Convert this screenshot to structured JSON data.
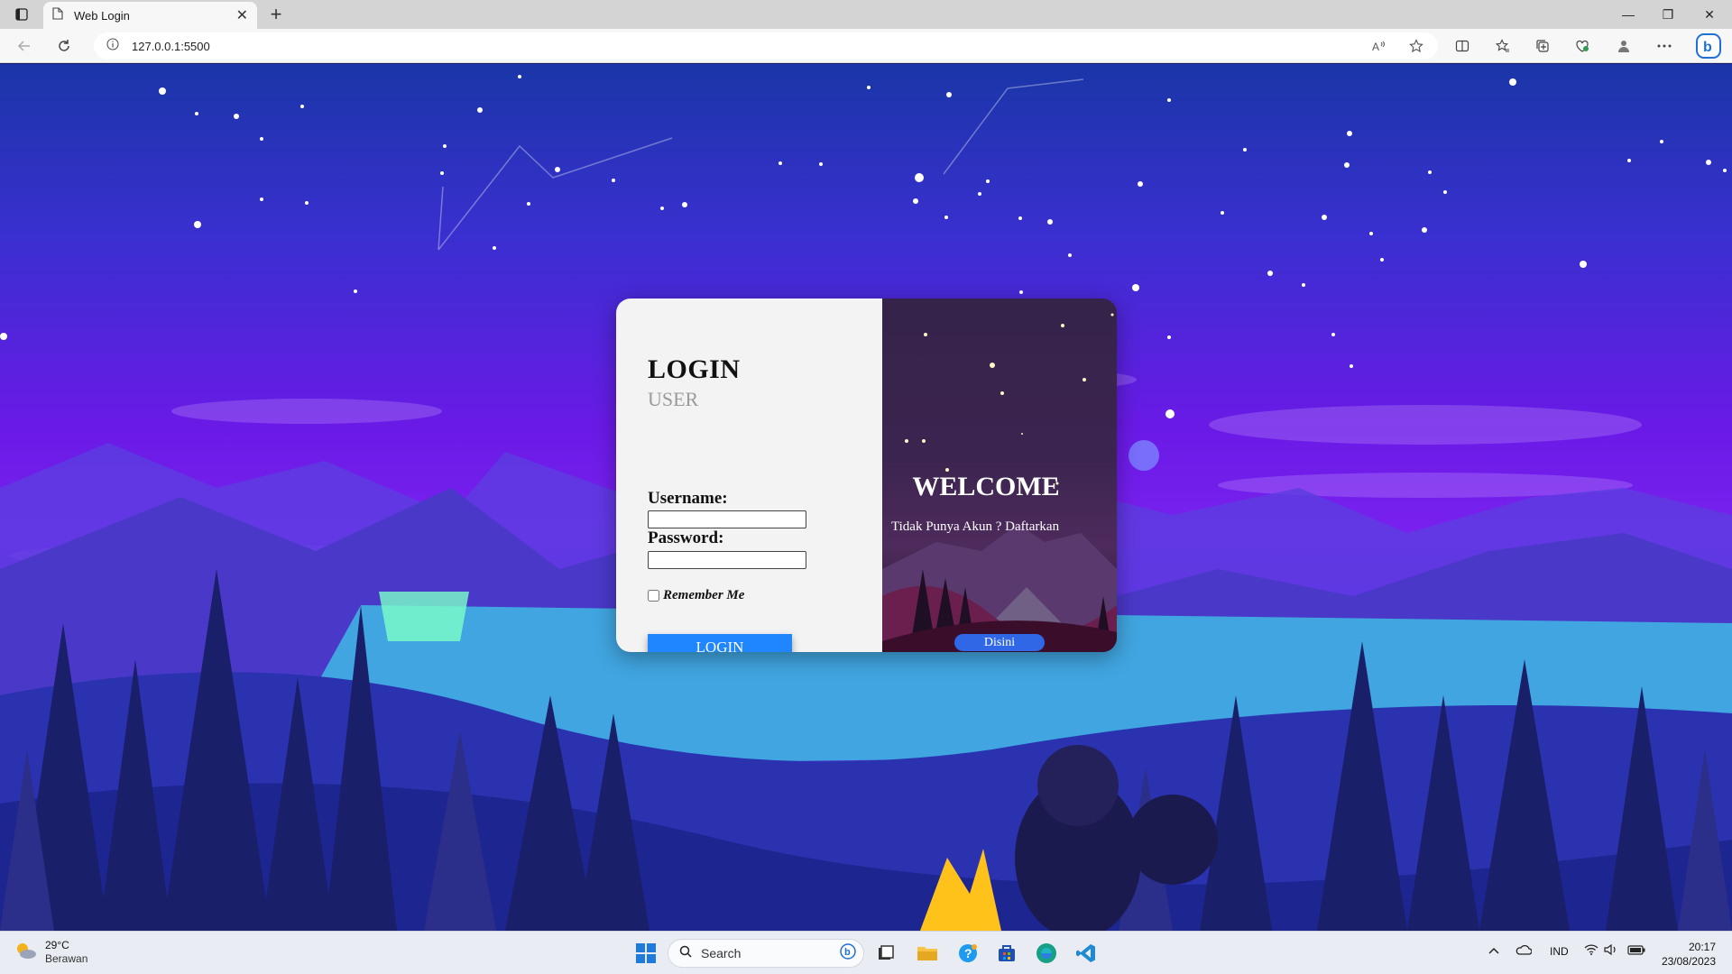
{
  "browser": {
    "tab_title": "Web Login",
    "tab_close": "✕",
    "new_tab": "+",
    "url": "127.0.0.1:5500",
    "min": "—",
    "restore": "❐",
    "close": "✕"
  },
  "login": {
    "title": "LOGIN",
    "subtitle": "USER",
    "username_label": "Username:",
    "password_label": "Password:",
    "remember_label": "Remember Me",
    "button_label": "LOGIN"
  },
  "welcome": {
    "title": "WELCOME",
    "subtitle": "Tidak Punya Akun ? Daftarkan",
    "button_label": "Disini"
  },
  "taskbar": {
    "temperature": "29°C",
    "condition": "Berawan",
    "search_placeholder": "Search",
    "language": "IND",
    "time": "20:17",
    "date": "23/08/2023"
  },
  "icons": [
    "tab-actions-icon",
    "page-icon",
    "back-icon",
    "refresh-icon",
    "info-icon",
    "read-aloud-icon",
    "favorite-star-icon",
    "split-screen-icon",
    "favorites-icon",
    "collections-icon",
    "browser-essentials-icon",
    "profile-icon",
    "more-icon",
    "copilot-icon",
    "windows-start-icon",
    "search-icon",
    "task-view-icon",
    "file-explorer-icon",
    "tips-icon",
    "store-icon",
    "edge-icon",
    "vscode-icon",
    "chevron-up-icon",
    "onedrive-icon",
    "wifi-icon",
    "volume-icon",
    "battery-icon"
  ],
  "colors": {
    "login_button": "#1f86ff",
    "disini_button": "#2f67e6",
    "card_left_bg": "#f3f3f3"
  }
}
